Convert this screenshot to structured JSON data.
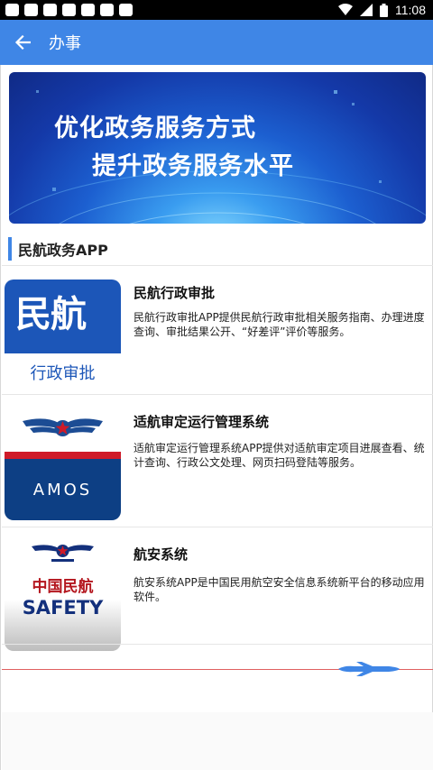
{
  "status_bar": {
    "time": "11:08"
  },
  "app_bar": {
    "title": "办事"
  },
  "banner": {
    "line1": "优化政务服务方式",
    "line2": "提升政务服务水平"
  },
  "section": {
    "title": "民航政务APP"
  },
  "apps": [
    {
      "name": "民航行政审批",
      "desc": "民航行政审批APP提供民航行政审批相关服务指南、办理进度查询、审批结果公开、“好差评”评价等服务。",
      "icon_big": "民航",
      "icon_small": "行政审批"
    },
    {
      "name": "适航审定运行管理系统",
      "desc": "适航审定运行管理系统APP提供对适航审定项目进展查看、统计查询、行政公文处理、网页扫码登陆等服务。",
      "icon_text": "AMOS"
    },
    {
      "name": "航安系统",
      "desc": "航安系统APP是中国民用航空安全信息系统新平台的移动应用软件。",
      "icon_cn": "中国民航",
      "icon_text": "SAFETY"
    }
  ],
  "colors": {
    "primary": "#3f86e6",
    "navy": "#0d3f84",
    "red": "#cf1a28"
  }
}
